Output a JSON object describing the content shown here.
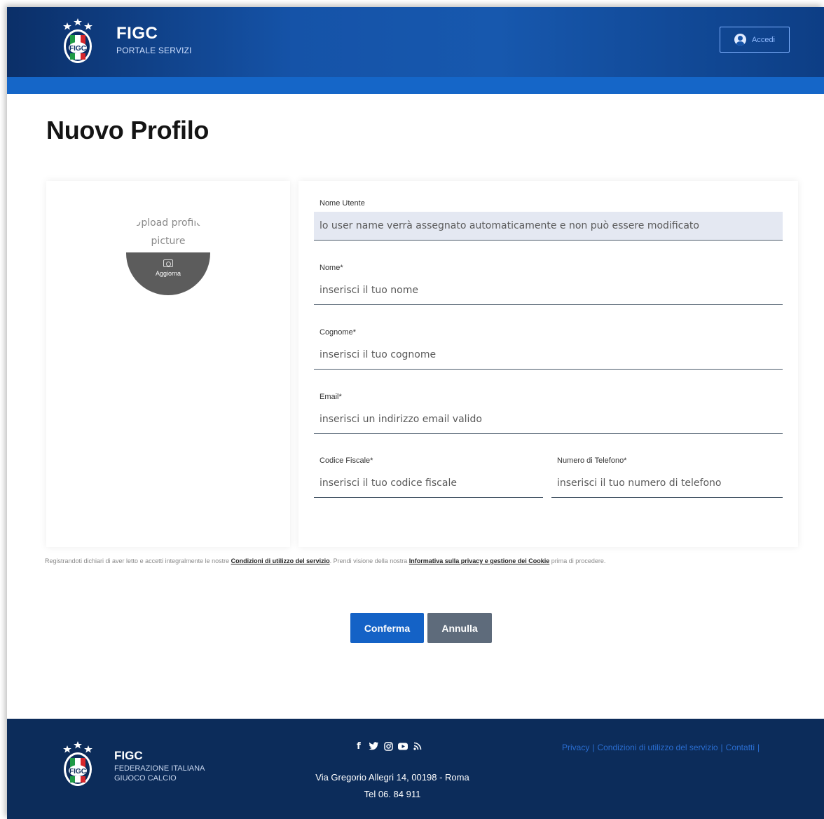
{
  "header": {
    "brand_title": "FIGC",
    "brand_subtitle": "PORTALE SERVIZI",
    "login_label": "Accedi",
    "logo_text": "FIGC"
  },
  "page_title": "Nuovo Profilo",
  "avatar": {
    "upload_text": "Upload profile picture",
    "update_label": "Aggiorna"
  },
  "form": {
    "username": {
      "label": "Nome Utente",
      "placeholder": "lo user name verrà assegnato automaticamente e non può essere modificato"
    },
    "first_name": {
      "label": "Nome*",
      "placeholder": "inserisci il tuo nome"
    },
    "last_name": {
      "label": "Cognome*",
      "placeholder": "inserisci il tuo cognome"
    },
    "email": {
      "label": "Email*",
      "placeholder": "inserisci un indirizzo email valido"
    },
    "tax_code": {
      "label": "Codice Fiscale*",
      "placeholder": "inserisci il tuo codice fiscale"
    },
    "phone": {
      "label": "Numero di Telefono*",
      "placeholder": "inserisci il tuo numero di telefono"
    }
  },
  "consent": {
    "text_before": "Registrandoti dichiari di aver letto e accetti integralmente le nostre ",
    "terms_link": "Condizioni di utilizzo del servizio",
    "text_middle": ". Prendi visione della nostra ",
    "privacy_link": "Informativa sulla privacy e gestione dei Cookie",
    "text_after": " prima di procedere."
  },
  "actions": {
    "confirm": "Conferma",
    "cancel": "Annulla"
  },
  "footer": {
    "title": "FIGC",
    "subtitle_line1": "FEDERAZIONE ITALIANA",
    "subtitle_line2": "GIUOCO CALCIO",
    "social_icons": [
      "facebook-icon",
      "twitter-icon",
      "instagram-icon",
      "youtube-icon",
      "rss-icon"
    ],
    "address": "Via Gregorio Allegri 14, 00198 - Roma",
    "phone": "Tel 06. 84 911",
    "links": {
      "privacy": "Privacy",
      "terms": "Condizioni di utilizzo del servizio",
      "contacts": "Contatti"
    }
  },
  "colors": {
    "header_blue": "#1553a8",
    "strip_blue": "#1566c8",
    "primary_button": "#1462c6",
    "secondary_button": "#5e6b7b",
    "footer_navy": "#0c2c5a",
    "footer_link": "#2a6dd0"
  }
}
